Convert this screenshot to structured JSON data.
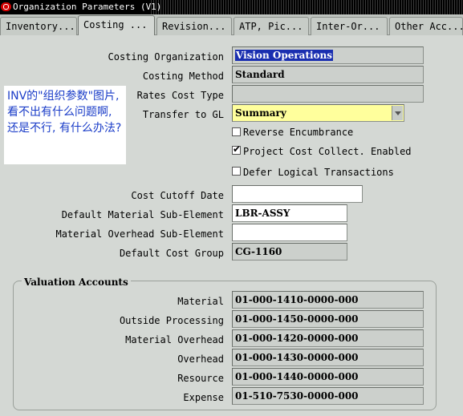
{
  "window": {
    "title": "Organization Parameters (V1)"
  },
  "tabs": [
    {
      "label": "Inventory...",
      "active": false
    },
    {
      "label": "Costing ...",
      "active": true
    },
    {
      "label": "Revision...",
      "active": false
    },
    {
      "label": "ATP, Pic...",
      "active": false
    },
    {
      "label": "Inter-Or...",
      "active": false
    },
    {
      "label": "Other Acc...",
      "active": false
    }
  ],
  "form": {
    "costing_organization": {
      "label": "Costing Organization",
      "value": "Vision Operations"
    },
    "costing_method": {
      "label": "Costing Method",
      "value": "Standard"
    },
    "rates_cost_type": {
      "label": "Rates Cost Type",
      "value": ""
    },
    "transfer_to_gl": {
      "label": "Transfer to GL",
      "value": "Summary"
    },
    "reverse_encumbrance": {
      "label": "Reverse Encumbrance",
      "checked": false
    },
    "project_cost_collect": {
      "label": "Project Cost Collect. Enabled",
      "checked": true
    },
    "defer_logical": {
      "label": "Defer Logical Transactions",
      "checked": false
    },
    "cost_cutoff_date": {
      "label": "Cost Cutoff Date",
      "value": ""
    },
    "default_material_sub_element": {
      "label": "Default Material Sub-Element",
      "value": "LBR-ASSY"
    },
    "material_overhead_sub_element": {
      "label": "Material Overhead Sub-Element",
      "value": ""
    },
    "default_cost_group": {
      "label": "Default Cost Group",
      "value": "CG-1160"
    }
  },
  "valuation": {
    "title": "Valuation Accounts",
    "rows": [
      {
        "label": "Material",
        "value": "01-000-1410-0000-000"
      },
      {
        "label": "Outside Processing",
        "value": "01-000-1450-0000-000"
      },
      {
        "label": "Material Overhead",
        "value": "01-000-1420-0000-000"
      },
      {
        "label": "Overhead",
        "value": "01-000-1430-0000-000"
      },
      {
        "label": "Resource",
        "value": "01-000-1440-0000-000"
      },
      {
        "label": "Expense",
        "value": "01-510-7530-0000-000"
      }
    ]
  },
  "annotation": {
    "text": "INV的\"组织参数\"图片, 看不出有什么问题啊, 还是不行, 有什么办法?"
  },
  "colors": {
    "selection": "#1a2fb0",
    "required_field": "#ffff9c",
    "annotation_text": "#1a3cc8"
  }
}
